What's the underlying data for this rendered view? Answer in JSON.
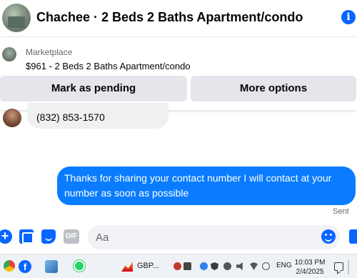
{
  "header": {
    "title": "Chachee · 2 Beds 2 Baths Apartment/condo",
    "info_icon": "info-icon",
    "info_glyph": "i"
  },
  "marketplace": {
    "label": "Marketplace",
    "listing": "$961 - 2 Beds 2 Baths Apartment/condo",
    "buttons": {
      "pending": "Mark as pending",
      "more": "More options"
    }
  },
  "messages": {
    "incoming": "(832) 853-1570",
    "outgoing": "Thanks for sharing your contact number I will contact at your number as soon as possible",
    "status": "Sent"
  },
  "composer": {
    "placeholder": "Aa",
    "plus_glyph": "+",
    "gif_label": "GIF"
  },
  "taskbar": {
    "facebook_glyph": "f",
    "stock_label": "GBP...",
    "language": "ENG",
    "time": "10:03 PM",
    "date": "2/4/2025"
  },
  "colors": {
    "accent": "#0866ff",
    "outgoing_bubble": "#0a7cff",
    "incoming_bubble": "#f0f0f0",
    "button_bg": "#e4e6eb"
  }
}
